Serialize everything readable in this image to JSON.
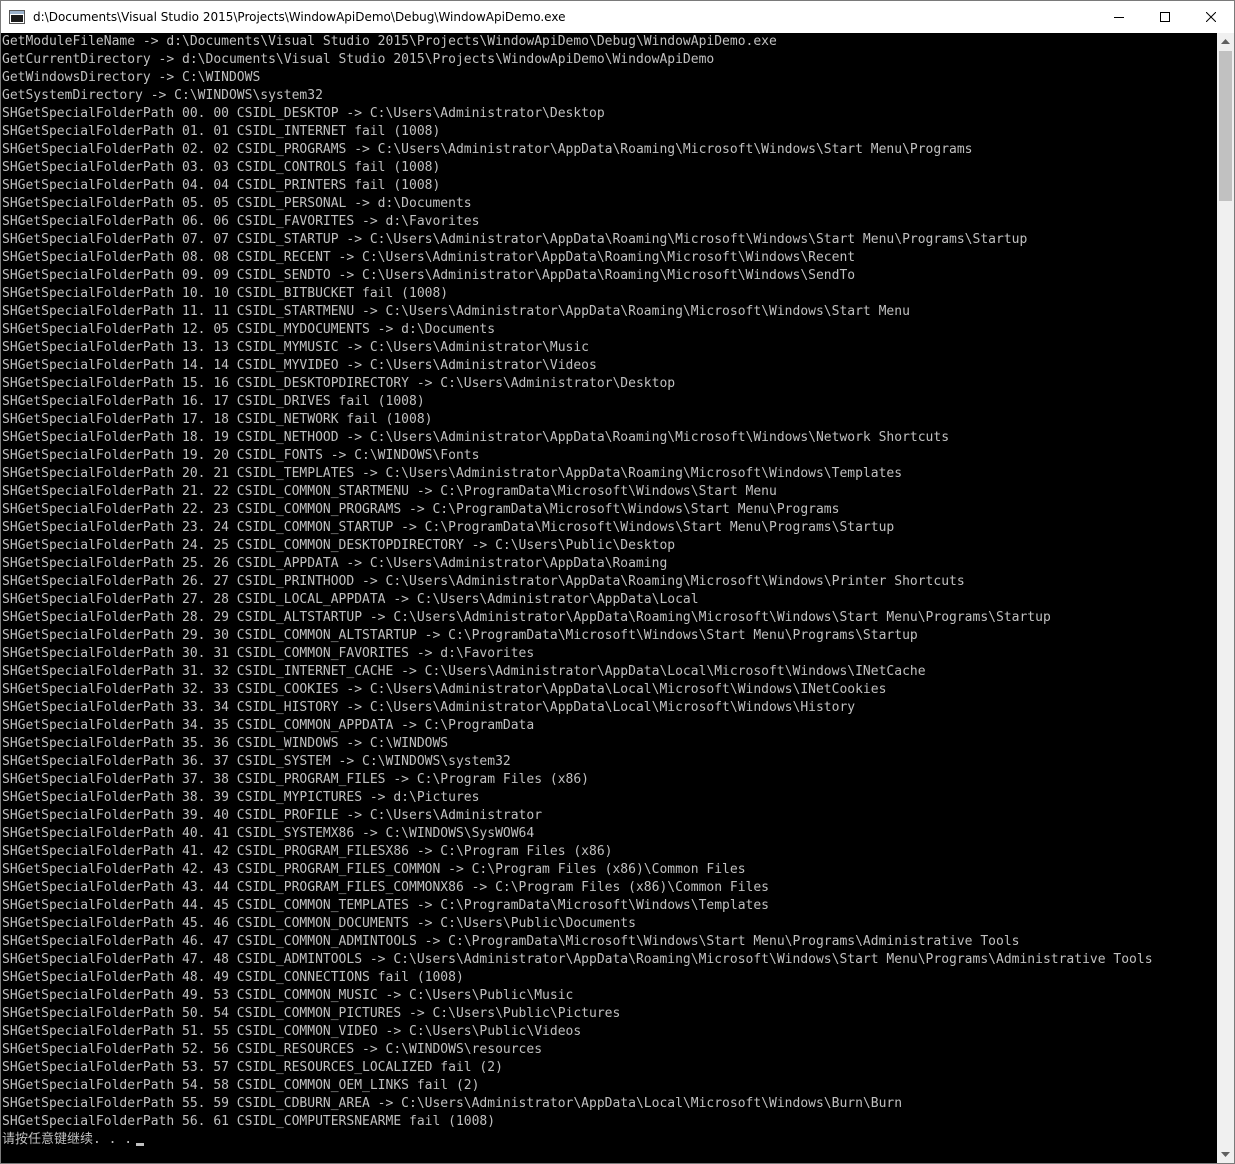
{
  "window": {
    "title": "d:\\Documents\\Visual Studio 2015\\Projects\\WindowApiDemo\\Debug\\WindowApiDemo.exe",
    "icon": "console-app-icon",
    "controls": {
      "minimize": "minimize-icon",
      "maximize": "maximize-icon",
      "close": "close-icon"
    }
  },
  "console": {
    "lines": [
      "GetModuleFileName -> d:\\Documents\\Visual Studio 2015\\Projects\\WindowApiDemo\\Debug\\WindowApiDemo.exe",
      "GetCurrentDirectory -> d:\\Documents\\Visual Studio 2015\\Projects\\WindowApiDemo\\WindowApiDemo",
      "GetWindowsDirectory -> C:\\WINDOWS",
      "GetSystemDirectory -> C:\\WINDOWS\\system32",
      "SHGetSpecialFolderPath 00. 00 CSIDL_DESKTOP -> C:\\Users\\Administrator\\Desktop",
      "SHGetSpecialFolderPath 01. 01 CSIDL_INTERNET fail (1008)",
      "SHGetSpecialFolderPath 02. 02 CSIDL_PROGRAMS -> C:\\Users\\Administrator\\AppData\\Roaming\\Microsoft\\Windows\\Start Menu\\Programs",
      "SHGetSpecialFolderPath 03. 03 CSIDL_CONTROLS fail (1008)",
      "SHGetSpecialFolderPath 04. 04 CSIDL_PRINTERS fail (1008)",
      "SHGetSpecialFolderPath 05. 05 CSIDL_PERSONAL -> d:\\Documents",
      "SHGetSpecialFolderPath 06. 06 CSIDL_FAVORITES -> d:\\Favorites",
      "SHGetSpecialFolderPath 07. 07 CSIDL_STARTUP -> C:\\Users\\Administrator\\AppData\\Roaming\\Microsoft\\Windows\\Start Menu\\Programs\\Startup",
      "SHGetSpecialFolderPath 08. 08 CSIDL_RECENT -> C:\\Users\\Administrator\\AppData\\Roaming\\Microsoft\\Windows\\Recent",
      "SHGetSpecialFolderPath 09. 09 CSIDL_SENDTO -> C:\\Users\\Administrator\\AppData\\Roaming\\Microsoft\\Windows\\SendTo",
      "SHGetSpecialFolderPath 10. 10 CSIDL_BITBUCKET fail (1008)",
      "SHGetSpecialFolderPath 11. 11 CSIDL_STARTMENU -> C:\\Users\\Administrator\\AppData\\Roaming\\Microsoft\\Windows\\Start Menu",
      "SHGetSpecialFolderPath 12. 05 CSIDL_MYDOCUMENTS -> d:\\Documents",
      "SHGetSpecialFolderPath 13. 13 CSIDL_MYMUSIC -> C:\\Users\\Administrator\\Music",
      "SHGetSpecialFolderPath 14. 14 CSIDL_MYVIDEO -> C:\\Users\\Administrator\\Videos",
      "SHGetSpecialFolderPath 15. 16 CSIDL_DESKTOPDIRECTORY -> C:\\Users\\Administrator\\Desktop",
      "SHGetSpecialFolderPath 16. 17 CSIDL_DRIVES fail (1008)",
      "SHGetSpecialFolderPath 17. 18 CSIDL_NETWORK fail (1008)",
      "SHGetSpecialFolderPath 18. 19 CSIDL_NETHOOD -> C:\\Users\\Administrator\\AppData\\Roaming\\Microsoft\\Windows\\Network Shortcuts",
      "SHGetSpecialFolderPath 19. 20 CSIDL_FONTS -> C:\\WINDOWS\\Fonts",
      "SHGetSpecialFolderPath 20. 21 CSIDL_TEMPLATES -> C:\\Users\\Administrator\\AppData\\Roaming\\Microsoft\\Windows\\Templates",
      "SHGetSpecialFolderPath 21. 22 CSIDL_COMMON_STARTMENU -> C:\\ProgramData\\Microsoft\\Windows\\Start Menu",
      "SHGetSpecialFolderPath 22. 23 CSIDL_COMMON_PROGRAMS -> C:\\ProgramData\\Microsoft\\Windows\\Start Menu\\Programs",
      "SHGetSpecialFolderPath 23. 24 CSIDL_COMMON_STARTUP -> C:\\ProgramData\\Microsoft\\Windows\\Start Menu\\Programs\\Startup",
      "SHGetSpecialFolderPath 24. 25 CSIDL_COMMON_DESKTOPDIRECTORY -> C:\\Users\\Public\\Desktop",
      "SHGetSpecialFolderPath 25. 26 CSIDL_APPDATA -> C:\\Users\\Administrator\\AppData\\Roaming",
      "SHGetSpecialFolderPath 26. 27 CSIDL_PRINTHOOD -> C:\\Users\\Administrator\\AppData\\Roaming\\Microsoft\\Windows\\Printer Shortcuts",
      "SHGetSpecialFolderPath 27. 28 CSIDL_LOCAL_APPDATA -> C:\\Users\\Administrator\\AppData\\Local",
      "SHGetSpecialFolderPath 28. 29 CSIDL_ALTSTARTUP -> C:\\Users\\Administrator\\AppData\\Roaming\\Microsoft\\Windows\\Start Menu\\Programs\\Startup",
      "SHGetSpecialFolderPath 29. 30 CSIDL_COMMON_ALTSTARTUP -> C:\\ProgramData\\Microsoft\\Windows\\Start Menu\\Programs\\Startup",
      "SHGetSpecialFolderPath 30. 31 CSIDL_COMMON_FAVORITES -> d:\\Favorites",
      "SHGetSpecialFolderPath 31. 32 CSIDL_INTERNET_CACHE -> C:\\Users\\Administrator\\AppData\\Local\\Microsoft\\Windows\\INetCache",
      "SHGetSpecialFolderPath 32. 33 CSIDL_COOKIES -> C:\\Users\\Administrator\\AppData\\Local\\Microsoft\\Windows\\INetCookies",
      "SHGetSpecialFolderPath 33. 34 CSIDL_HISTORY -> C:\\Users\\Administrator\\AppData\\Local\\Microsoft\\Windows\\History",
      "SHGetSpecialFolderPath 34. 35 CSIDL_COMMON_APPDATA -> C:\\ProgramData",
      "SHGetSpecialFolderPath 35. 36 CSIDL_WINDOWS -> C:\\WINDOWS",
      "SHGetSpecialFolderPath 36. 37 CSIDL_SYSTEM -> C:\\WINDOWS\\system32",
      "SHGetSpecialFolderPath 37. 38 CSIDL_PROGRAM_FILES -> C:\\Program Files (x86)",
      "SHGetSpecialFolderPath 38. 39 CSIDL_MYPICTURES -> d:\\Pictures",
      "SHGetSpecialFolderPath 39. 40 CSIDL_PROFILE -> C:\\Users\\Administrator",
      "SHGetSpecialFolderPath 40. 41 CSIDL_SYSTEMX86 -> C:\\WINDOWS\\SysWOW64",
      "SHGetSpecialFolderPath 41. 42 CSIDL_PROGRAM_FILESX86 -> C:\\Program Files (x86)",
      "SHGetSpecialFolderPath 42. 43 CSIDL_PROGRAM_FILES_COMMON -> C:\\Program Files (x86)\\Common Files",
      "SHGetSpecialFolderPath 43. 44 CSIDL_PROGRAM_FILES_COMMONX86 -> C:\\Program Files (x86)\\Common Files",
      "SHGetSpecialFolderPath 44. 45 CSIDL_COMMON_TEMPLATES -> C:\\ProgramData\\Microsoft\\Windows\\Templates",
      "SHGetSpecialFolderPath 45. 46 CSIDL_COMMON_DOCUMENTS -> C:\\Users\\Public\\Documents",
      "SHGetSpecialFolderPath 46. 47 CSIDL_COMMON_ADMINTOOLS -> C:\\ProgramData\\Microsoft\\Windows\\Start Menu\\Programs\\Administrative Tools",
      "SHGetSpecialFolderPath 47. 48 CSIDL_ADMINTOOLS -> C:\\Users\\Administrator\\AppData\\Roaming\\Microsoft\\Windows\\Start Menu\\Programs\\Administrative Tools",
      "SHGetSpecialFolderPath 48. 49 CSIDL_CONNECTIONS fail (1008)",
      "SHGetSpecialFolderPath 49. 53 CSIDL_COMMON_MUSIC -> C:\\Users\\Public\\Music",
      "SHGetSpecialFolderPath 50. 54 CSIDL_COMMON_PICTURES -> C:\\Users\\Public\\Pictures",
      "SHGetSpecialFolderPath 51. 55 CSIDL_COMMON_VIDEO -> C:\\Users\\Public\\Videos",
      "SHGetSpecialFolderPath 52. 56 CSIDL_RESOURCES -> C:\\WINDOWS\\resources",
      "SHGetSpecialFolderPath 53. 57 CSIDL_RESOURCES_LOCALIZED fail (2)",
      "SHGetSpecialFolderPath 54. 58 CSIDL_COMMON_OEM_LINKS fail (2)",
      "SHGetSpecialFolderPath 55. 59 CSIDL_CDBURN_AREA -> C:\\Users\\Administrator\\AppData\\Local\\Microsoft\\Windows\\Burn\\Burn",
      "SHGetSpecialFolderPath 56. 61 CSIDL_COMPUTERSNEARME fail (1008)"
    ],
    "prompt": "请按任意键继续. . ."
  },
  "scrollbar": {
    "up_icon": "scroll-up-arrow-icon",
    "down_icon": "scroll-down-arrow-icon"
  },
  "colors": {
    "console_bg": "#000000",
    "console_text": "#c0c0c0",
    "titlebar_bg": "#ffffff"
  }
}
